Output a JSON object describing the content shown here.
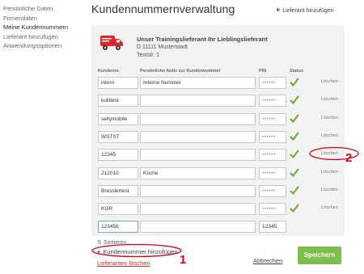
{
  "sidebar": {
    "items": [
      {
        "label": "Persönliche Daten",
        "active": false
      },
      {
        "label": "Firmendaten",
        "active": false
      },
      {
        "label": "Meine Kundennummern",
        "active": true
      },
      {
        "label": "Lieferant hinzufügen",
        "active": false
      },
      {
        "label": "Anwendungsoptionen",
        "active": false
      }
    ]
  },
  "header": {
    "title": "Kundennummernverwaltung",
    "add_supplier_plus": "+",
    "add_supplier": "Lieferant hinzufügen"
  },
  "supplier": {
    "name": "Unser Trainingslieferant Ihr Lieblingslieferant",
    "city": "D 11111 Musterstadt",
    "street": "Teststr. 1",
    "icon": "truck-icon"
  },
  "table": {
    "headers": {
      "number": "Kundennr.",
      "note": "Persönliche Notiz zur Kundennummer",
      "pin": "PIN",
      "status": "Status"
    },
    "delete_label": "Löschen",
    "rows": [
      {
        "number": "intern",
        "note": "Interne Nummer",
        "pin": "••••••",
        "ok": true
      },
      {
        "number": "kollitest",
        "note": "",
        "pin": "••••••",
        "ok": true
      },
      {
        "number": "sellymobile",
        "note": "",
        "pin": "••••••",
        "ok": true
      },
      {
        "number": "WSTST",
        "note": "",
        "pin": "••••••",
        "ok": true
      },
      {
        "number": "12345",
        "note": "",
        "pin": "••••••",
        "ok": true
      },
      {
        "number": "212010",
        "note": "Küche",
        "pin": "••••••",
        "ok": true
      },
      {
        "number": "Bresslertest",
        "note": "",
        "pin": "••••••",
        "ok": true
      },
      {
        "number": "KGR",
        "note": "",
        "pin": "••••••",
        "ok": true
      },
      {
        "number": "123456",
        "note": "",
        "pin": "12345",
        "ok": false
      }
    ]
  },
  "footer": {
    "sort_icon": "sort-icon",
    "sort": "Sortieren",
    "add_number_plus": "+",
    "add_number": "Kundennummer hinzufügen",
    "delete_supplier": "Lieferanten löschen",
    "cancel": "Abbrechen",
    "save": "Speichern"
  },
  "annotations": {
    "marker_1": "1",
    "marker_2": "2"
  },
  "colors": {
    "accent_green": "#7cc04b",
    "check_green": "#6aa832",
    "truck_red": "#e3242b",
    "annotation_red": "#d0021b",
    "danger_link": "#cc2b2b"
  }
}
